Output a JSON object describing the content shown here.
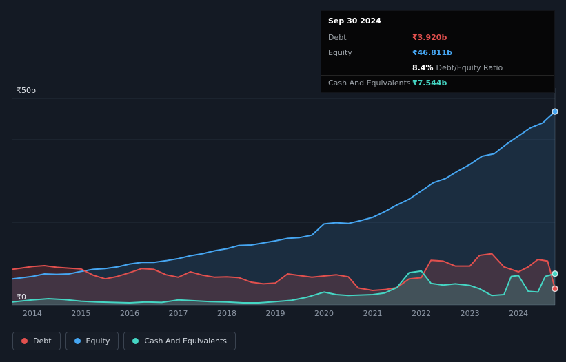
{
  "colors": {
    "debt": "#e2504e",
    "equity": "#46a6f2",
    "cash": "#45d6c4",
    "background": "#141a24"
  },
  "tooltip": {
    "date": "Sep 30 2024",
    "debt": {
      "label": "Debt",
      "value": "₹3.920b"
    },
    "equity": {
      "label": "Equity",
      "value": "₹46.811b"
    },
    "ratio": {
      "value": "8.4%",
      "label": "Debt/Equity Ratio"
    },
    "cash": {
      "label": "Cash And Equivalents",
      "value": "₹7.544b"
    }
  },
  "chart_data": {
    "type": "area",
    "x_range": [
      2013.59,
      2024.75
    ],
    "y_range": [
      0,
      50
    ],
    "y_gridlines": [
      0,
      20,
      40,
      50
    ],
    "y_axis_labels": [
      {
        "value": 50,
        "label": "₹50b"
      },
      {
        "value": 0,
        "label": "₹0"
      }
    ],
    "x_ticks": [
      "2014",
      "2015",
      "2016",
      "2017",
      "2018",
      "2019",
      "2020",
      "2021",
      "2022",
      "2023",
      "2024"
    ],
    "x_tick_years": [
      2014,
      2015,
      2016,
      2017,
      2018,
      2019,
      2020,
      2021,
      2022,
      2023,
      2024
    ],
    "grid": true,
    "legend_position": "bottom-left",
    "legend": [
      "Debt",
      "Equity",
      "Cash And Equivalents"
    ],
    "series": [
      {
        "name": "Equity",
        "color": "#46a6f2",
        "fill": "rgba(70,166,242,0.14)",
        "points": [
          [
            2013.59,
            6.3
          ],
          [
            2014.0,
            6.9
          ],
          [
            2014.25,
            7.5
          ],
          [
            2014.5,
            7.4
          ],
          [
            2014.75,
            7.5
          ],
          [
            2015.0,
            8.1
          ],
          [
            2015.25,
            8.6
          ],
          [
            2015.5,
            8.8
          ],
          [
            2015.75,
            9.2
          ],
          [
            2016.0,
            9.9
          ],
          [
            2016.25,
            10.3
          ],
          [
            2016.5,
            10.3
          ],
          [
            2016.75,
            10.7
          ],
          [
            2017.0,
            11.2
          ],
          [
            2017.25,
            11.9
          ],
          [
            2017.5,
            12.4
          ],
          [
            2017.75,
            13.1
          ],
          [
            2018.0,
            13.6
          ],
          [
            2018.25,
            14.4
          ],
          [
            2018.5,
            14.5
          ],
          [
            2018.75,
            15.0
          ],
          [
            2019.0,
            15.5
          ],
          [
            2019.25,
            16.1
          ],
          [
            2019.5,
            16.3
          ],
          [
            2019.75,
            16.9
          ],
          [
            2020.0,
            19.6
          ],
          [
            2020.25,
            19.9
          ],
          [
            2020.5,
            19.7
          ],
          [
            2020.75,
            20.4
          ],
          [
            2021.0,
            21.2
          ],
          [
            2021.25,
            22.6
          ],
          [
            2021.5,
            24.2
          ],
          [
            2021.75,
            25.6
          ],
          [
            2022.0,
            27.6
          ],
          [
            2022.25,
            29.6
          ],
          [
            2022.5,
            30.6
          ],
          [
            2022.75,
            32.4
          ],
          [
            2023.0,
            34.0
          ],
          [
            2023.25,
            36.0
          ],
          [
            2023.5,
            36.6
          ],
          [
            2023.75,
            38.9
          ],
          [
            2024.0,
            40.9
          ],
          [
            2024.25,
            42.9
          ],
          [
            2024.5,
            44.1
          ],
          [
            2024.75,
            46.811
          ]
        ]
      },
      {
        "name": "Debt",
        "color": "#e2504e",
        "fill": "rgba(226,80,78,0.20)",
        "points": [
          [
            2013.59,
            8.6
          ],
          [
            2014.0,
            9.3
          ],
          [
            2014.25,
            9.5
          ],
          [
            2014.5,
            9.1
          ],
          [
            2014.75,
            8.9
          ],
          [
            2015.0,
            8.7
          ],
          [
            2015.25,
            7.2
          ],
          [
            2015.5,
            6.3
          ],
          [
            2015.75,
            6.9
          ],
          [
            2016.0,
            7.8
          ],
          [
            2016.25,
            8.8
          ],
          [
            2016.5,
            8.6
          ],
          [
            2016.75,
            7.3
          ],
          [
            2017.0,
            6.7
          ],
          [
            2017.25,
            8.0
          ],
          [
            2017.5,
            7.2
          ],
          [
            2017.75,
            6.7
          ],
          [
            2018.0,
            6.8
          ],
          [
            2018.25,
            6.6
          ],
          [
            2018.5,
            5.5
          ],
          [
            2018.75,
            5.1
          ],
          [
            2019.0,
            5.3
          ],
          [
            2019.25,
            7.5
          ],
          [
            2019.5,
            7.1
          ],
          [
            2019.75,
            6.7
          ],
          [
            2020.0,
            7.0
          ],
          [
            2020.25,
            7.3
          ],
          [
            2020.5,
            6.8
          ],
          [
            2020.7,
            4.1
          ],
          [
            2021.0,
            3.5
          ],
          [
            2021.25,
            3.7
          ],
          [
            2021.5,
            4.2
          ],
          [
            2021.75,
            6.3
          ],
          [
            2022.0,
            6.6
          ],
          [
            2022.2,
            10.8
          ],
          [
            2022.45,
            10.6
          ],
          [
            2022.7,
            9.4
          ],
          [
            2023.0,
            9.4
          ],
          [
            2023.2,
            12.0
          ],
          [
            2023.45,
            12.4
          ],
          [
            2023.7,
            9.2
          ],
          [
            2024.0,
            8.0
          ],
          [
            2024.2,
            9.2
          ],
          [
            2024.4,
            11.0
          ],
          [
            2024.6,
            10.6
          ],
          [
            2024.75,
            3.92
          ]
        ]
      },
      {
        "name": "Cash And Equivalents",
        "color": "#45d6c4",
        "fill": "rgba(69,214,196,0.18)",
        "points": [
          [
            2013.59,
            0.7
          ],
          [
            2014.0,
            1.2
          ],
          [
            2014.33,
            1.5
          ],
          [
            2014.66,
            1.3
          ],
          [
            2015.0,
            0.9
          ],
          [
            2015.33,
            0.7
          ],
          [
            2015.66,
            0.6
          ],
          [
            2016.0,
            0.5
          ],
          [
            2016.33,
            0.7
          ],
          [
            2016.66,
            0.6
          ],
          [
            2017.0,
            1.2
          ],
          [
            2017.33,
            1.0
          ],
          [
            2017.66,
            0.8
          ],
          [
            2018.0,
            0.7
          ],
          [
            2018.33,
            0.5
          ],
          [
            2018.66,
            0.5
          ],
          [
            2019.0,
            0.8
          ],
          [
            2019.33,
            1.1
          ],
          [
            2019.66,
            1.9
          ],
          [
            2020.0,
            3.1
          ],
          [
            2020.25,
            2.5
          ],
          [
            2020.5,
            2.3
          ],
          [
            2020.75,
            2.4
          ],
          [
            2021.0,
            2.5
          ],
          [
            2021.25,
            2.9
          ],
          [
            2021.5,
            4.2
          ],
          [
            2021.75,
            7.8
          ],
          [
            2022.0,
            8.2
          ],
          [
            2022.2,
            5.2
          ],
          [
            2022.45,
            4.8
          ],
          [
            2022.7,
            5.1
          ],
          [
            2023.0,
            4.7
          ],
          [
            2023.2,
            3.9
          ],
          [
            2023.45,
            2.3
          ],
          [
            2023.7,
            2.5
          ],
          [
            2023.85,
            6.9
          ],
          [
            2024.0,
            7.1
          ],
          [
            2024.2,
            3.3
          ],
          [
            2024.4,
            3.1
          ],
          [
            2024.55,
            6.9
          ],
          [
            2024.75,
            7.544
          ]
        ]
      }
    ]
  }
}
